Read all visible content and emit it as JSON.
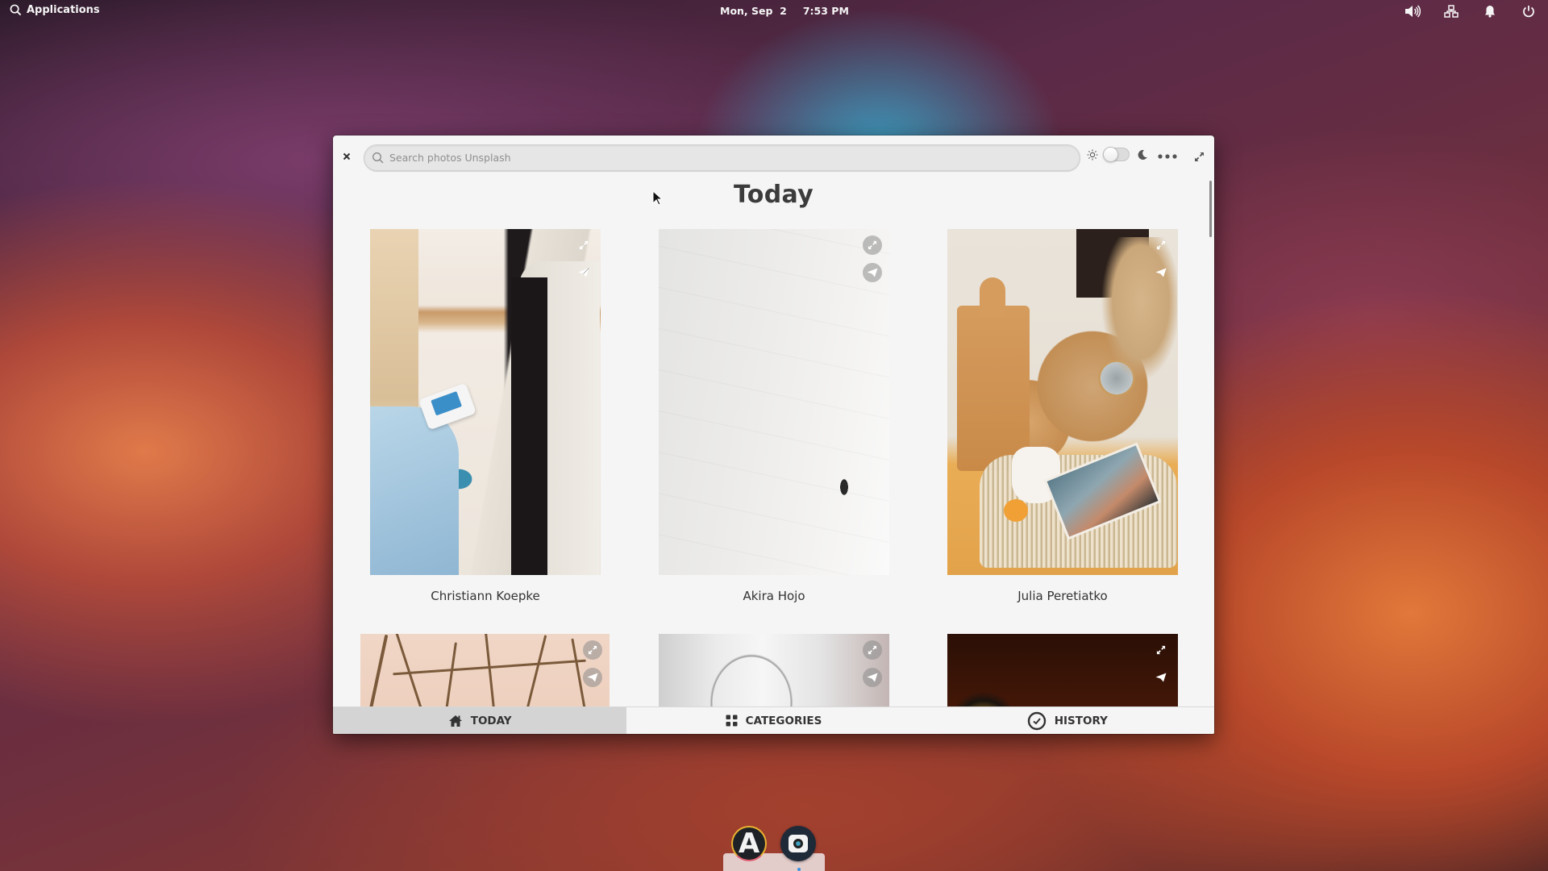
{
  "panel": {
    "applications_label": "Applications",
    "date": "Mon, Sep  2",
    "time": "7:53 PM",
    "indicators": [
      {
        "name": "sound-icon"
      },
      {
        "name": "network-icon"
      },
      {
        "name": "notifications-icon"
      },
      {
        "name": "power-icon"
      }
    ]
  },
  "window": {
    "search": {
      "placeholder": "Search photos Unsplash",
      "value": ""
    },
    "theme_toggle": {
      "dark_mode": false
    },
    "title": "Today",
    "photos": [
      {
        "author": "Christiann Koepke"
      },
      {
        "author": "Akira Hojo"
      },
      {
        "author": "Julia Peretiatko"
      },
      {
        "author": ""
      },
      {
        "author": ""
      },
      {
        "author": ""
      }
    ],
    "tabs": [
      {
        "label": "TODAY",
        "icon": "home-icon",
        "active": true
      },
      {
        "label": "CATEGORIES",
        "icon": "grid-icon",
        "active": false
      },
      {
        "label": "HISTORY",
        "icon": "clock-icon",
        "active": false
      }
    ]
  },
  "dock": {
    "apps": [
      {
        "name": "AppCenter",
        "glyph": "A"
      },
      {
        "name": "Camera"
      }
    ]
  }
}
